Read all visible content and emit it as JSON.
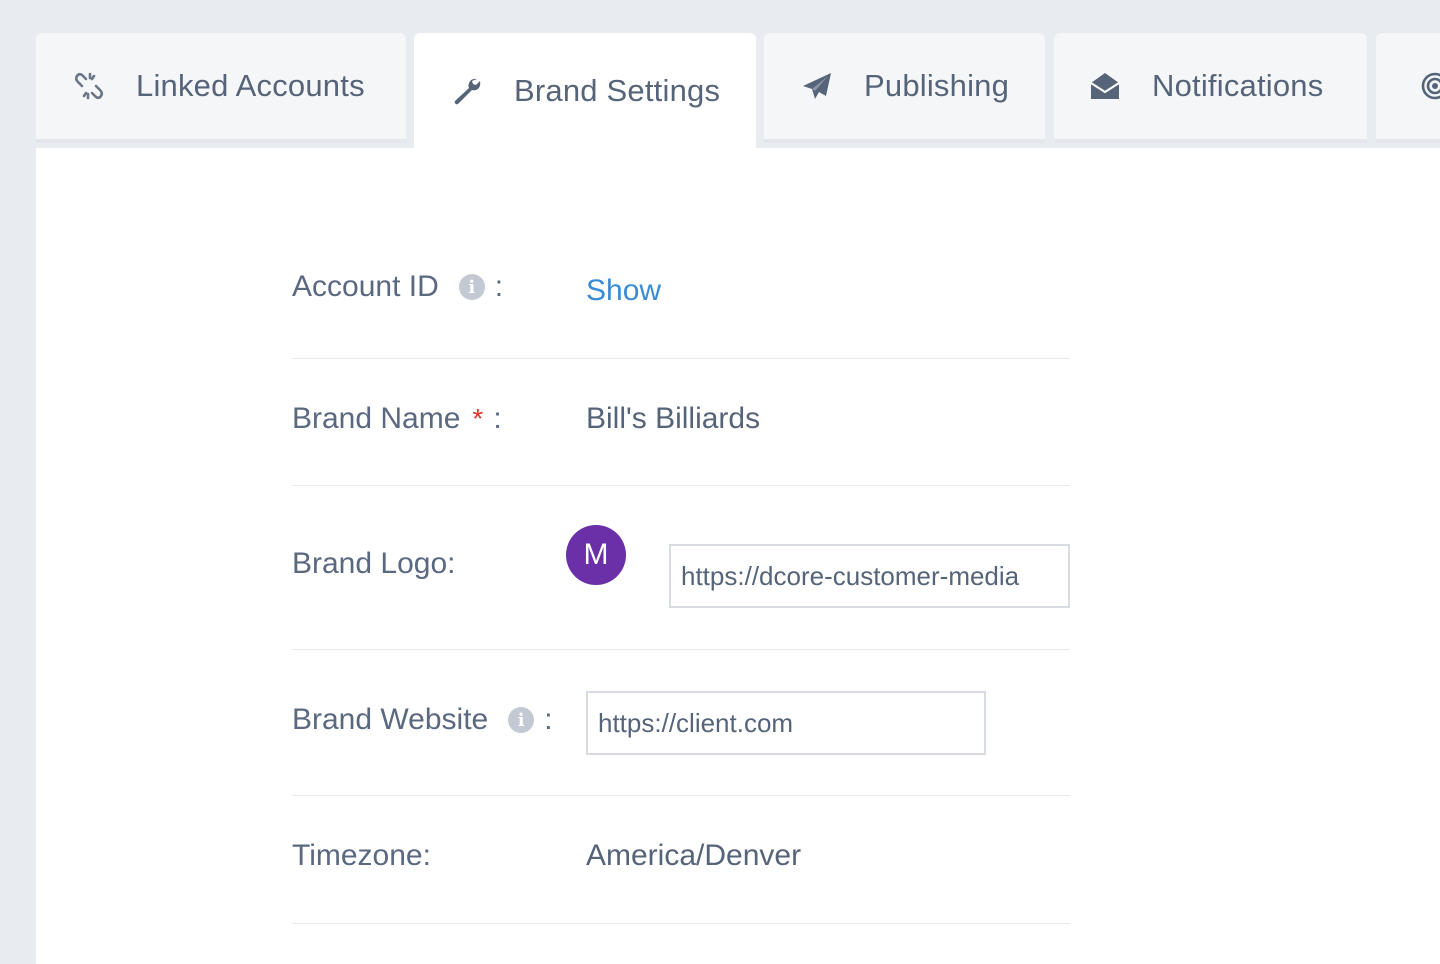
{
  "tabs": [
    {
      "label": "Linked Accounts",
      "icon": "broken-link-icon"
    },
    {
      "label": "Brand Settings",
      "icon": "wrench-icon"
    },
    {
      "label": "Publishing",
      "icon": "paper-plane-icon"
    },
    {
      "label": "Notifications",
      "icon": "open-envelope-icon"
    },
    {
      "label": "",
      "icon": "target-icon"
    }
  ],
  "form": {
    "account_id": {
      "label": "Account ID",
      "colon": ":",
      "value": "Show"
    },
    "brand_name": {
      "label": "Brand Name",
      "required_mark": "*",
      "colon": ":",
      "value": "Bill's Billiards"
    },
    "brand_logo": {
      "label": "Brand Logo:",
      "avatar_letter": "M",
      "url_value": "https://dcore-customer-media"
    },
    "brand_website": {
      "label": "Brand Website",
      "colon": ":",
      "value": "https://client.com"
    },
    "timezone": {
      "label": "Timezone:",
      "value": "America/Denver"
    }
  },
  "colors": {
    "link": "#3a8bd6",
    "required": "#e0342c",
    "avatar": "#6b2fa8",
    "page_bg": "#e8ebf0",
    "tab_inactive_bg": "#f5f6f8"
  }
}
